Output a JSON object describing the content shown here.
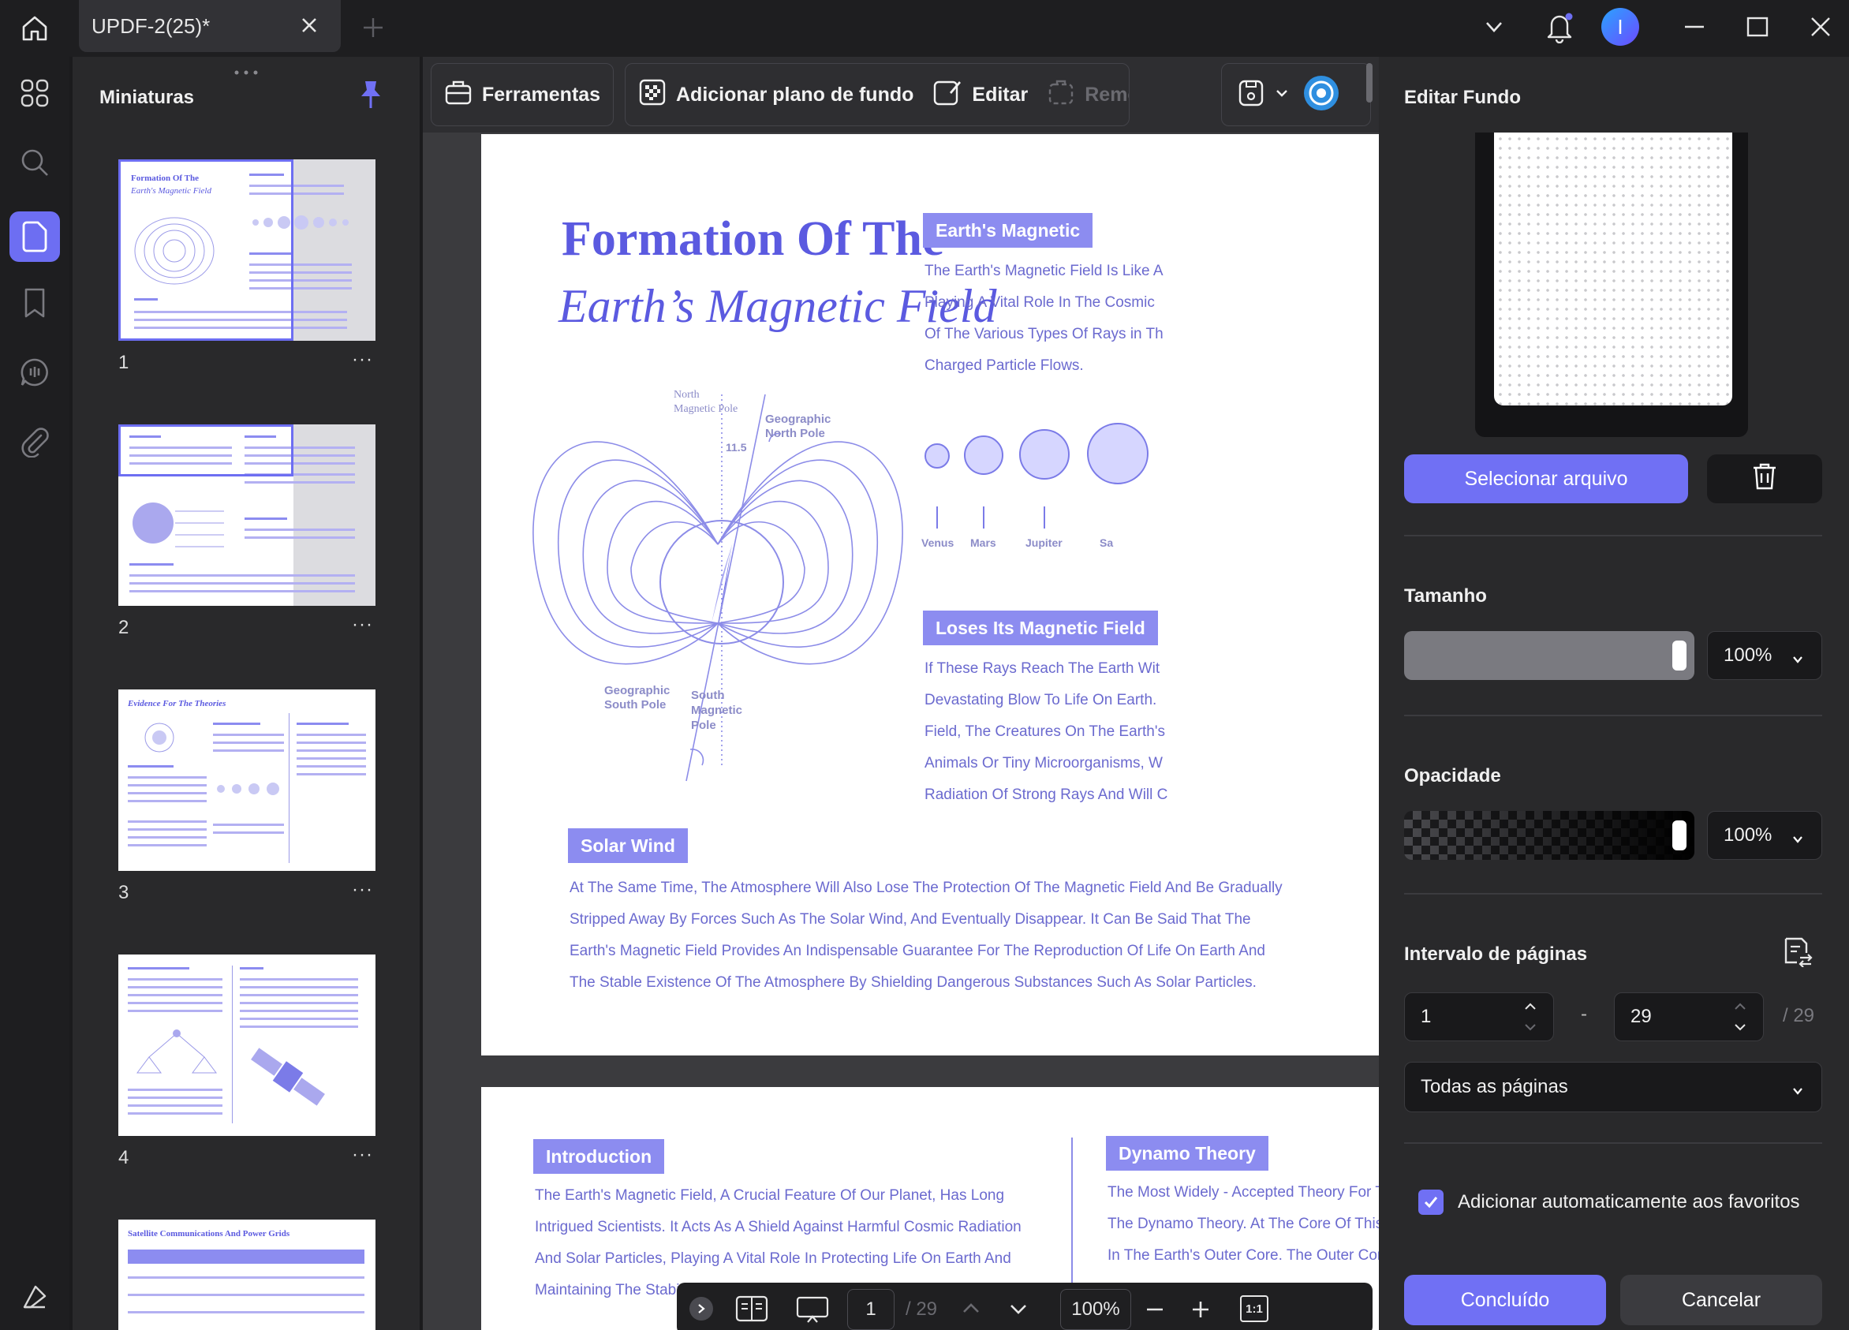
{
  "titlebar": {
    "tab_title": "UPDF-2(25)*",
    "avatar_initial": "I"
  },
  "thumbnails": {
    "title": "Miniaturas",
    "pages": [
      {
        "number": "1",
        "heading": "Formation Of The",
        "subheading": "Earth's Magnetic Field"
      },
      {
        "number": "2"
      },
      {
        "number": "3",
        "heading": "Evidence For The Theories"
      },
      {
        "number": "4"
      },
      {
        "number": "5",
        "heading": "Satellite Communications And Power Grids"
      }
    ],
    "more": "···"
  },
  "toolbar": {
    "tools": "Ferramentas",
    "add_background": "Adicionar plano de fundo",
    "edit": "Editar",
    "remove": "Remover"
  },
  "document": {
    "page1": {
      "title_line1": "Formation Of The",
      "title_line2": "Earth’s Magnetic Field",
      "diagram_labels": {
        "north": "North",
        "magnetic_pole": "Magnetic Pole",
        "geo_north_1": "Geographic",
        "geo_north_2": "North Pole",
        "angle": "11.5",
        "geo_south_1": "Geographic",
        "geo_south_2": "South Pole",
        "south_mag_1": "South",
        "south_mag_2": "Magnetic",
        "south_mag_3": "Pole"
      },
      "earths_magnetic": {
        "heading": "Earth's Magnetic",
        "lines": [
          "The Earth's Magnetic Field Is Like A",
          "Playing A Vital Role In The Cosmic",
          "Of The Various Types Of Rays in Th",
          "Charged Particle Flows."
        ]
      },
      "planets": [
        "Venus",
        "Mars",
        "Jupiter",
        "Sa"
      ],
      "loses": {
        "heading": "Loses Its Magnetic Field",
        "lines": [
          "If These Rays Reach The Earth Wit",
          "Devastating Blow To Life On Earth.",
          "Field, The Creatures On The Earth's",
          "Animals Or Tiny Microorganisms, W",
          "Radiation Of Strong Rays And Will C"
        ]
      },
      "solar_wind": {
        "heading": "Solar Wind",
        "lines": [
          "At The Same Time, The Atmosphere Will Also Lose The Protection Of The Magnetic Field And Be Gradually",
          "Stripped Away By Forces Such As The Solar Wind, And Eventually Disappear. It Can Be Said That The",
          "Earth's Magnetic Field Provides An Indispensable Guarantee For The Reproduction Of Life On Earth And",
          "The Stable Existence Of The Atmosphere By Shielding Dangerous Substances Such As Solar Particles."
        ]
      }
    },
    "page2": {
      "introduction": {
        "heading": "Introduction",
        "lines": [
          "The Earth's Magnetic Field, A Crucial Feature Of Our Planet, Has Long",
          "Intrigued Scientists. It Acts As A Shield Against Harmful Cosmic Radiation",
          "And Solar Particles, Playing A Vital Role In Protecting Life On Earth And",
          "Maintaining The Stabi"
        ]
      },
      "dynamo": {
        "heading": "Dynamo Theory",
        "lines": [
          "The Most Widely - Accepted Theory For T",
          "The Dynamo Theory. At The Core Of This",
          "In The Earth's Outer Core. The Outer Cor"
        ]
      }
    }
  },
  "page_nav": {
    "current": "1",
    "total": "/ 29",
    "zoom": "100%",
    "fit": "1:1"
  },
  "edit_background": {
    "title": "Editar Fundo",
    "select_file": "Selecionar arquivo",
    "size_label": "Tamanho",
    "size_value": "100%",
    "size_level": 1.0,
    "opacity_label": "Opacidade",
    "opacity_value": "100%",
    "opacity_level": 1.0,
    "page_range_label": "Intervalo de páginas",
    "range_from": "1",
    "range_dash": "-",
    "range_to": "29",
    "range_total": "/ 29",
    "range_option": "Todas as páginas",
    "auto_favorites": "Adicionar automaticamente aos favoritos",
    "auto_favorites_checked": true,
    "done": "Concluído",
    "cancel": "Cancelar"
  },
  "colors": {
    "accent": "#7070f4",
    "doc_text": "#6b6acf",
    "pill": "#8c8cf0"
  }
}
